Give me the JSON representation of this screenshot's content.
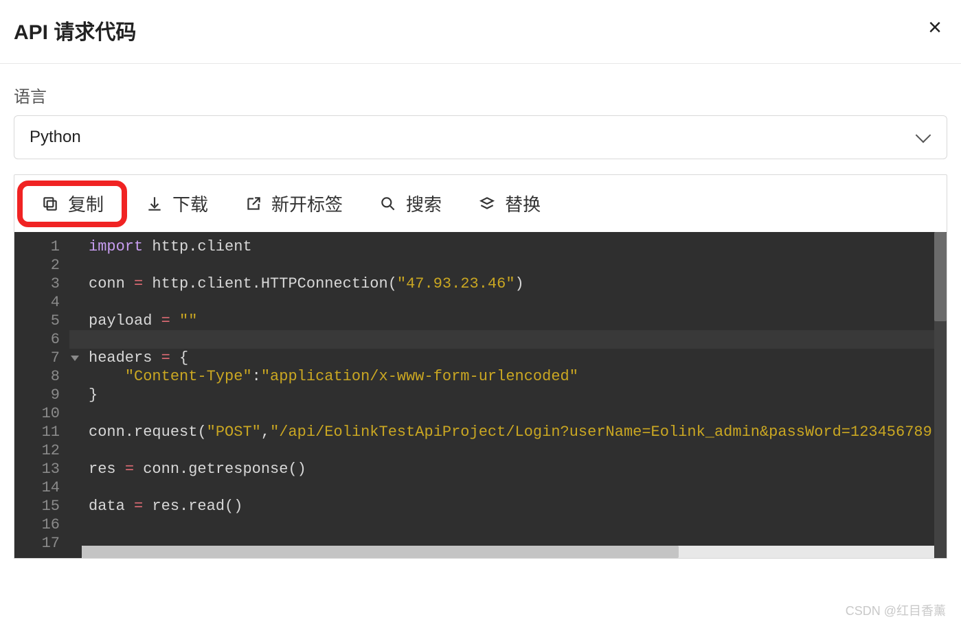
{
  "modal": {
    "title": "API 请求代码",
    "close_glyph": "×"
  },
  "form": {
    "language_label": "语言",
    "language_value": "Python"
  },
  "toolbar": {
    "copy": "复制",
    "download": "下载",
    "open_tab": "新开标签",
    "search": "搜索",
    "replace": "替换"
  },
  "editor": {
    "line_numbers": [
      "1",
      "2",
      "3",
      "4",
      "5",
      "6",
      "7",
      "8",
      "9",
      "10",
      "11",
      "12",
      "13",
      "14",
      "15",
      "16",
      "17"
    ],
    "active_line_index": 5,
    "fold_marker_line": 7,
    "code_lines": [
      [
        {
          "t": "import",
          "c": "kw"
        },
        {
          "t": " ",
          "c": "id"
        },
        {
          "t": "http.client",
          "c": "id"
        }
      ],
      [],
      [
        {
          "t": "conn ",
          "c": "id"
        },
        {
          "t": "=",
          "c": "op"
        },
        {
          "t": " http.client.",
          "c": "id"
        },
        {
          "t": "HTTPConnection",
          "c": "fn"
        },
        {
          "t": "(",
          "c": "pn"
        },
        {
          "t": "\"47.93.23.46\"",
          "c": "str"
        },
        {
          "t": ")",
          "c": "pn"
        }
      ],
      [],
      [
        {
          "t": "payload ",
          "c": "id"
        },
        {
          "t": "=",
          "c": "op"
        },
        {
          "t": " ",
          "c": "id"
        },
        {
          "t": "\"\"",
          "c": "str"
        }
      ],
      [],
      [
        {
          "t": "headers ",
          "c": "id"
        },
        {
          "t": "=",
          "c": "op"
        },
        {
          "t": " {",
          "c": "pn"
        }
      ],
      [
        {
          "t": "    ",
          "c": "id"
        },
        {
          "t": "\"Content-Type\"",
          "c": "str"
        },
        {
          "t": ":",
          "c": "pn"
        },
        {
          "t": "\"application/x-www-form-urlencoded\"",
          "c": "str"
        }
      ],
      [
        {
          "t": "}",
          "c": "pn"
        }
      ],
      [],
      [
        {
          "t": "conn.",
          "c": "id"
        },
        {
          "t": "request",
          "c": "fn"
        },
        {
          "t": "(",
          "c": "pn"
        },
        {
          "t": "\"POST\"",
          "c": "str"
        },
        {
          "t": ",",
          "c": "pn"
        },
        {
          "t": "\"/api/EolinkTestApiProject/Login?userName=Eolink_admin&passWord=123456789",
          "c": "str"
        }
      ],
      [],
      [
        {
          "t": "res ",
          "c": "id"
        },
        {
          "t": "=",
          "c": "op"
        },
        {
          "t": " conn.",
          "c": "id"
        },
        {
          "t": "getresponse",
          "c": "fn"
        },
        {
          "t": "()",
          "c": "pn"
        }
      ],
      [],
      [
        {
          "t": "data ",
          "c": "id"
        },
        {
          "t": "=",
          "c": "op"
        },
        {
          "t": " res.",
          "c": "id"
        },
        {
          "t": "read",
          "c": "fn"
        },
        {
          "t": "()",
          "c": "pn"
        }
      ],
      [],
      []
    ]
  },
  "watermark": "CSDN @红目香薰"
}
